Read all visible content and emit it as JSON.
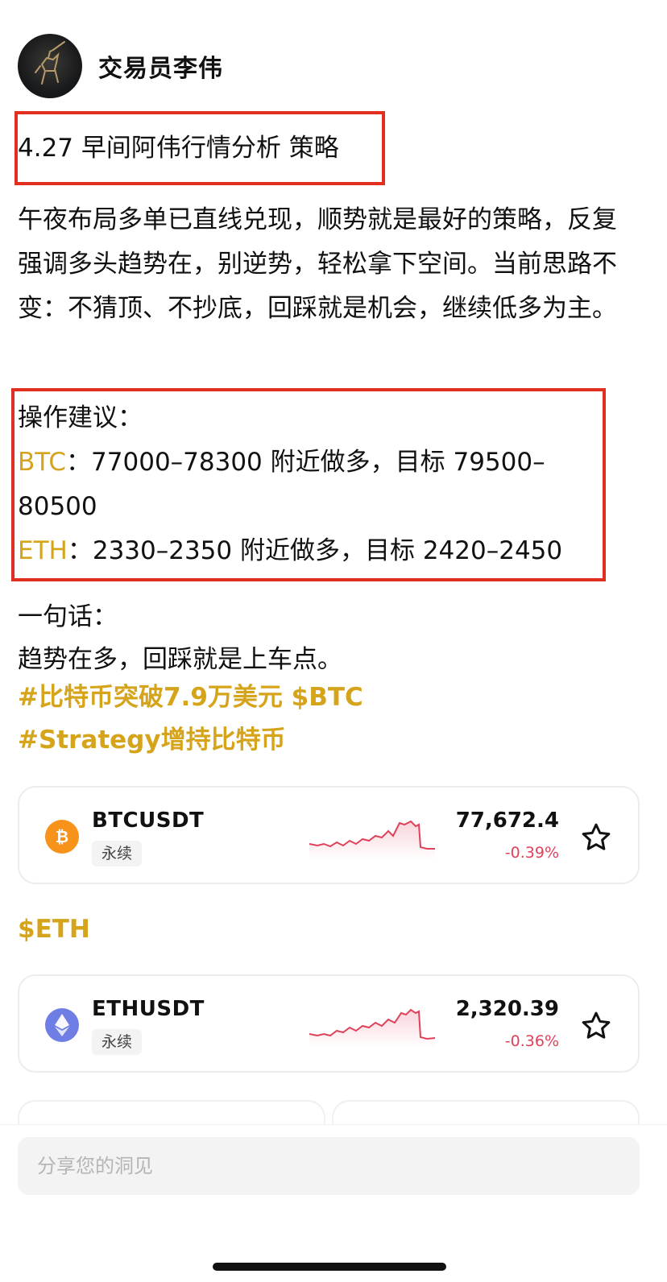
{
  "post": {
    "author": "交易员李伟",
    "title": "4.27 早间阿伟行情分析 策略",
    "paragraph": "午夜布局多单已直线兑现，顺势就是最好的策略，反复强调多头趋势在，别逆势，轻松拿下空间。当前思路不变：不猜顶、不抄底，回踩就是机会，继续低多为主。",
    "ops_heading": "操作建议：",
    "btc_label": "BTC",
    "btc_text": "：77000–78300 附近做多，目标 79500–80500",
    "eth_label": "ETH",
    "eth_text": "：2330–2350 附近做多，目标 2420–2450",
    "summary_heading": "一句话：",
    "summary_text": "趋势在多，回踩就是上车点。",
    "tags": [
      "#比特币突破7.9万美元 $BTC",
      "#Strategy增持比特币"
    ],
    "eth_tag": "$ETH"
  },
  "cards": [
    {
      "symbol": "BTCUSDT",
      "badge": "永续",
      "price": "77,672.4",
      "change": "-0.39%",
      "coin_icon": "bitcoin-icon",
      "coin_color": "#f7931a"
    },
    {
      "symbol": "ETHUSDT",
      "badge": "永续",
      "price": "2,320.39",
      "change": "-0.36%",
      "coin_icon": "ethereum-icon",
      "coin_color": "#6f7ee4"
    }
  ],
  "composer": {
    "placeholder": "分享您的洞见"
  },
  "colors": {
    "accent_gold": "#d6a41b",
    "highlight_red": "#e12f20",
    "negative": "#e0415a"
  }
}
